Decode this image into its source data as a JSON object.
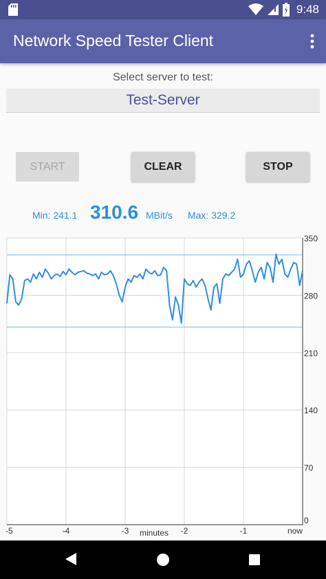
{
  "status_bar": {
    "time": "9:48",
    "icons": [
      "sd-card-icon",
      "wifi-icon",
      "signal-icon",
      "battery-icon"
    ]
  },
  "app_bar": {
    "title": "Network Speed Tester Client",
    "menu_icon": "more-vert-icon"
  },
  "server": {
    "prompt": "Select server to test:",
    "value": "Test-Server"
  },
  "buttons": {
    "start": "START",
    "clear": "CLEAR",
    "stop": "STOP",
    "start_enabled": false
  },
  "stats": {
    "min": "Min: 241.1",
    "current": "310.6",
    "unit": "MBit/s",
    "max": "Max: 329.2"
  },
  "colors": {
    "accent": "#2f8ee0",
    "app_bar": "#5c62a8",
    "status_bar": "#4a4f8f"
  },
  "chart_data": {
    "type": "line",
    "title": "",
    "xlabel": "minutes",
    "ylabel": "",
    "xlim": [
      -5,
      0
    ],
    "ylim": [
      0,
      350
    ],
    "x_ticks": [
      "-5",
      "-4",
      "-3",
      "-2",
      "-1",
      "now"
    ],
    "y_ticks": [
      "350",
      "280",
      "210",
      "140",
      "70",
      "0"
    ],
    "reference_lines": {
      "max": 329.2,
      "min": 241.1
    },
    "grid": true,
    "series": [
      {
        "x": [
          -5.0,
          -4.95,
          -4.9,
          -4.85,
          -4.8,
          -4.75,
          -4.7,
          -4.65,
          -4.6,
          -4.55,
          -4.5,
          -4.45,
          -4.4,
          -4.35,
          -4.3,
          -4.25,
          -4.2,
          -4.15,
          -4.1,
          -4.05,
          -4.0,
          -3.95,
          -3.9,
          -3.85,
          -3.8,
          -3.75,
          -3.7,
          -3.65,
          -3.6,
          -3.55,
          -3.5,
          -3.45,
          -3.4,
          -3.35,
          -3.3,
          -3.25,
          -3.2,
          -3.15,
          -3.1,
          -3.05,
          -3.0,
          -2.95,
          -2.9,
          -2.85,
          -2.8,
          -2.75,
          -2.7,
          -2.65,
          -2.6,
          -2.55,
          -2.5,
          -2.45,
          -2.4,
          -2.35,
          -2.3,
          -2.25,
          -2.2,
          -2.15,
          -2.1,
          -2.05,
          -2.0,
          -1.95,
          -1.9,
          -1.85,
          -1.8,
          -1.75,
          -1.7,
          -1.65,
          -1.6,
          -1.55,
          -1.5,
          -1.45,
          -1.4,
          -1.35,
          -1.3,
          -1.25,
          -1.2,
          -1.15,
          -1.1,
          -1.05,
          -1.0,
          -0.95,
          -0.9,
          -0.85,
          -0.8,
          -0.75,
          -0.7,
          -0.65,
          -0.6,
          -0.55,
          -0.5,
          -0.45,
          -0.4,
          -0.35,
          -0.3,
          -0.25,
          -0.2,
          -0.15,
          -0.1,
          -0.05,
          0.0
        ],
        "y": [
          270,
          305,
          300,
          272,
          268,
          276,
          298,
          300,
          296,
          306,
          300,
          308,
          302,
          312,
          307,
          300,
          304,
          306,
          303,
          309,
          305,
          312,
          308,
          305,
          308,
          309,
          310,
          307,
          306,
          304,
          306,
          300,
          308,
          305,
          306,
          310,
          304,
          294,
          280,
          272,
          290,
          300,
          296,
          304,
          302,
          306,
          300,
          312,
          308,
          306,
          310,
          304,
          305,
          314,
          310,
          268,
          250,
          278,
          268,
          246,
          300,
          294,
          292,
          298,
          290,
          296,
          300,
          292,
          276,
          262,
          290,
          294,
          270,
          300,
          306,
          304,
          308,
          312,
          324,
          302,
          306,
          318,
          322,
          310,
          296,
          308,
          314,
          300,
          320,
          314,
          296,
          330,
          318,
          324,
          306,
          302,
          312,
          320,
          318,
          292,
          310
        ]
      }
    ]
  }
}
